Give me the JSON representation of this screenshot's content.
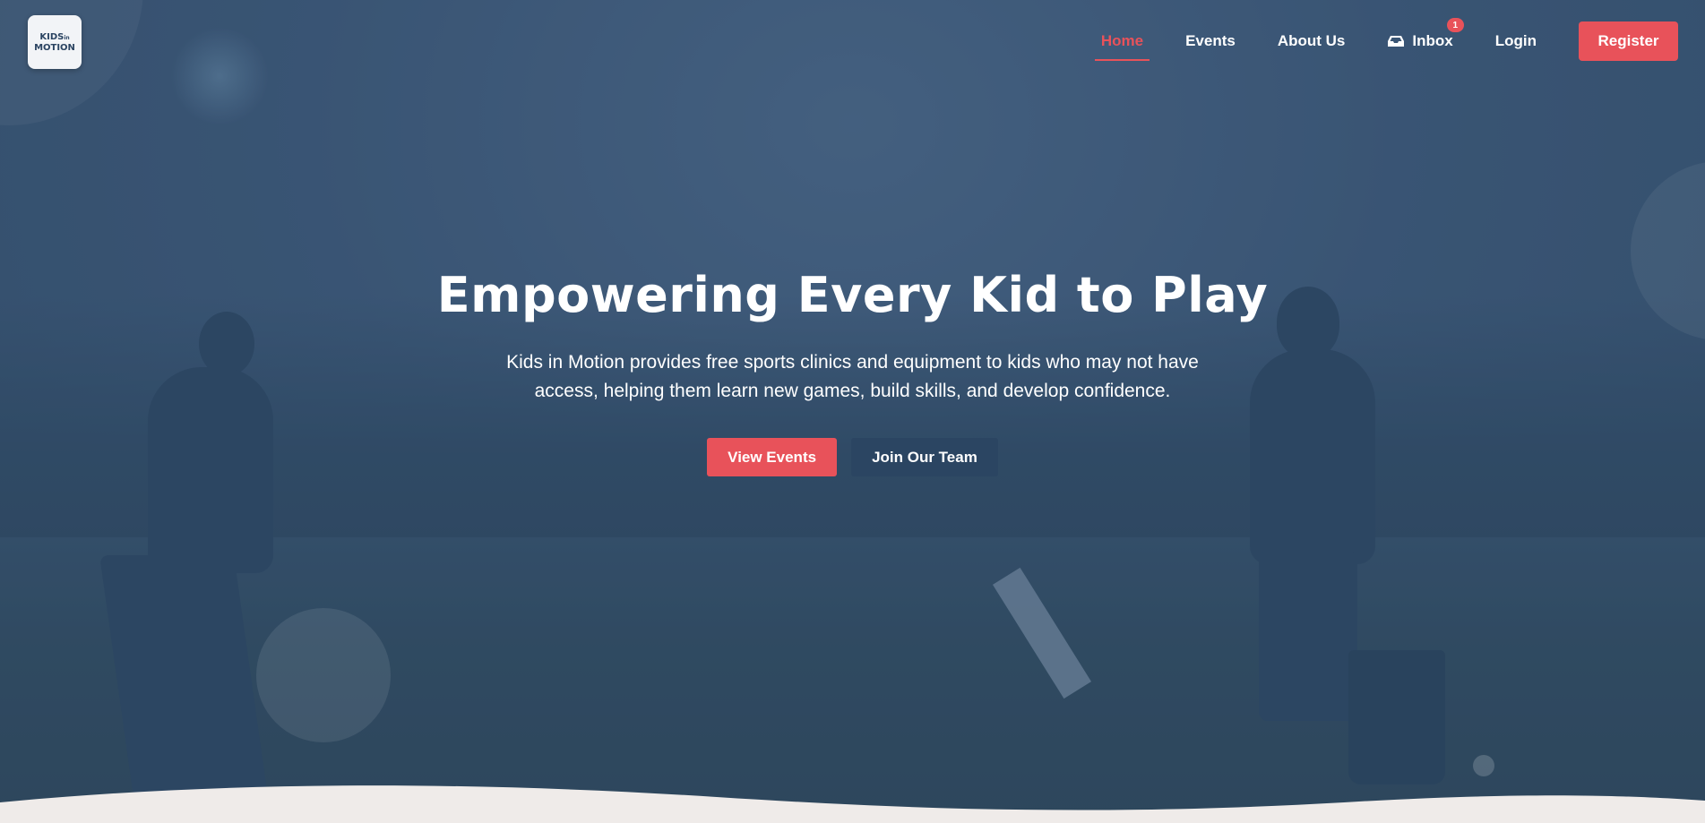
{
  "brand": {
    "logo_line1": "KIDS",
    "logo_line2": "MOTION",
    "logo_small": "in"
  },
  "nav": {
    "items": [
      {
        "label": "Home",
        "active": true
      },
      {
        "label": "Events"
      },
      {
        "label": "About Us"
      },
      {
        "label": "Inbox",
        "icon": "inbox-icon",
        "badge": "1"
      },
      {
        "label": "Login"
      }
    ],
    "register_label": "Register"
  },
  "hero": {
    "headline": "Empowering Every Kid to Play",
    "subtext": "Kids in Motion provides free sports clinics and equipment to kids who may not have access, helping them learn new games, build skills, and develop confidence.",
    "primary_cta": "View Events",
    "secondary_cta": "Join Our Team"
  },
  "colors": {
    "accent": "#e8525a",
    "navy": "#2b4562",
    "overlay": "#3a5574",
    "wave": "#efebe9"
  }
}
